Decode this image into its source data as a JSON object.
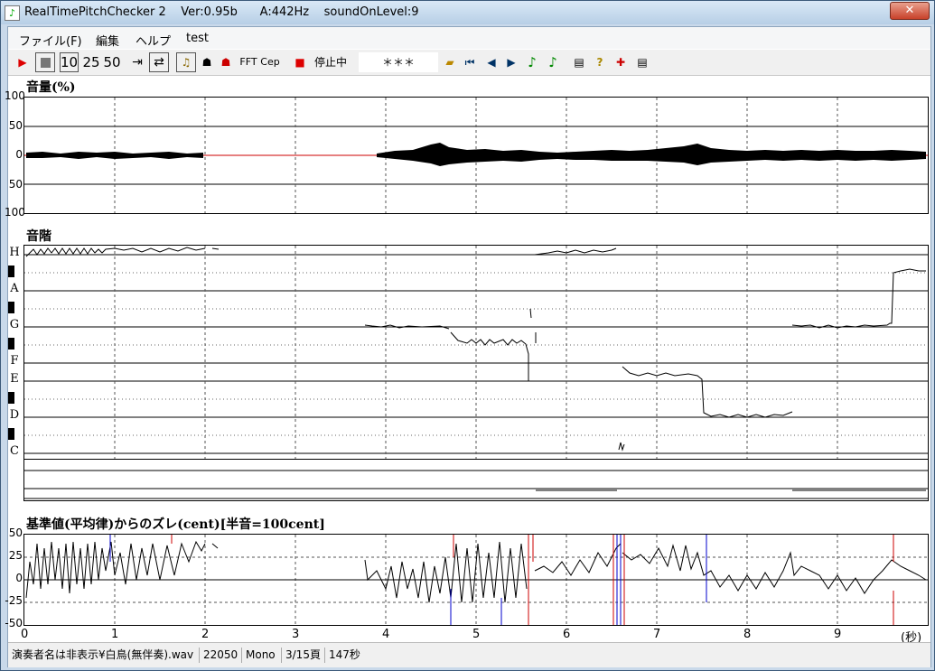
{
  "window": {
    "title": "RealTimePitchChecker 2    Ver:0.95b      A:442Hz    soundOnLevel:9",
    "close_label": "✕"
  },
  "menu": {
    "items": [
      "ファイル(F)",
      "編集",
      "ヘルプ",
      "test"
    ]
  },
  "toolbar": {
    "speed_options": [
      "10",
      "25",
      "50"
    ],
    "fft_label": "FFT",
    "cep_label": "Cep",
    "status_text": "停止中",
    "stars_text": "＊＊＊"
  },
  "volume_panel": {
    "title": "音量(%)",
    "ticks": [
      "100",
      "50",
      "0",
      "50",
      "100"
    ]
  },
  "scale_panel": {
    "title": "音階",
    "notes": [
      "H",
      "A",
      "G",
      "F",
      "E",
      "D",
      "C"
    ]
  },
  "deviation_panel": {
    "title": "基準値(平均律)からのズレ(cent)[半音=100cent]",
    "ticks": [
      "50",
      "25",
      "0",
      "-25",
      "-50"
    ]
  },
  "time_axis": {
    "labels": [
      "0",
      "1",
      "2",
      "3",
      "4",
      "5",
      "6",
      "7",
      "8",
      "9"
    ],
    "unit": "(秒)"
  },
  "statusbar": {
    "file": "演奏者名は非表示¥白鳥(無伴奏).wav",
    "rate": "22050",
    "channels": "Mono",
    "page": "3/15頁",
    "duration": "147秒"
  },
  "colors": {
    "accent_red": "#cc0000",
    "line_blue": "#0000cc"
  }
}
